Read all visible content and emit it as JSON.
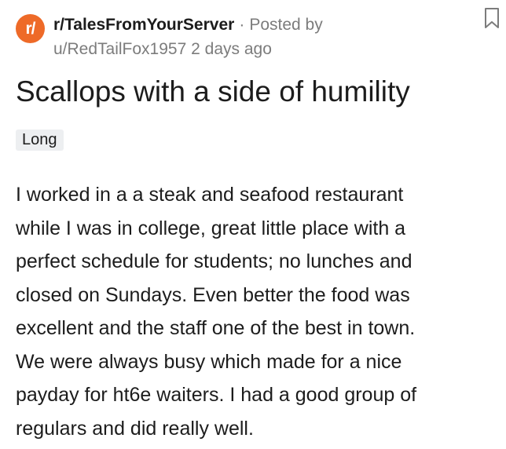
{
  "post": {
    "subreddit_icon": "r/",
    "subreddit": "r/TalesFromYourServer",
    "separator": "·",
    "posted_by": "Posted by",
    "author": "u/RedTailFox1957",
    "age": "2 days ago",
    "title": "Scallops with a side of humility",
    "flair": "Long",
    "body_lines": [
      "I worked in a a steak and seafood restaurant",
      "while I was in college, great little place with a",
      "perfect schedule for students; no lunches and",
      "closed on Sundays. Even better the food was",
      "excellent and the staff one of the best in town.",
      "We were always busy which made for a nice",
      "payday for ht6e waiters. I had a good group of",
      "regulars and did really well."
    ]
  },
  "icons": {
    "save": "bookmark-icon"
  },
  "colors": {
    "subreddit_icon_bg": "#ee6a28",
    "meta_gray": "#7c7c7c",
    "flair_bg": "#edeff1"
  }
}
